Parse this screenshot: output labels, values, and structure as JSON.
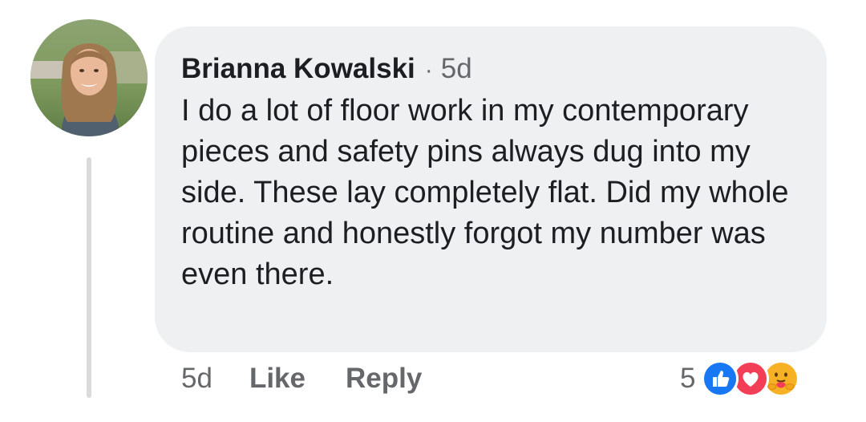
{
  "comment": {
    "author_name": "Brianna Kowalski",
    "separator": "·",
    "header_time": "5d",
    "text": "I do a lot of floor work in my contemporary pieces and safety pins always dug into my side. These lay completely flat. Did my whole routine and honestly forgot my number was even there."
  },
  "actions": {
    "time": "5d",
    "like_label": "Like",
    "reply_label": "Reply"
  },
  "reactions": {
    "count": "5",
    "icons": [
      "thumbs-up-icon",
      "heart-icon",
      "care-hug-icon"
    ],
    "colors": {
      "like": "#1877f2",
      "love": "#f33e58",
      "care": "#f7b125"
    }
  },
  "colors": {
    "bubble_background": "#eef0f2",
    "text": "#1c1e21",
    "secondary_text": "#65676b"
  }
}
